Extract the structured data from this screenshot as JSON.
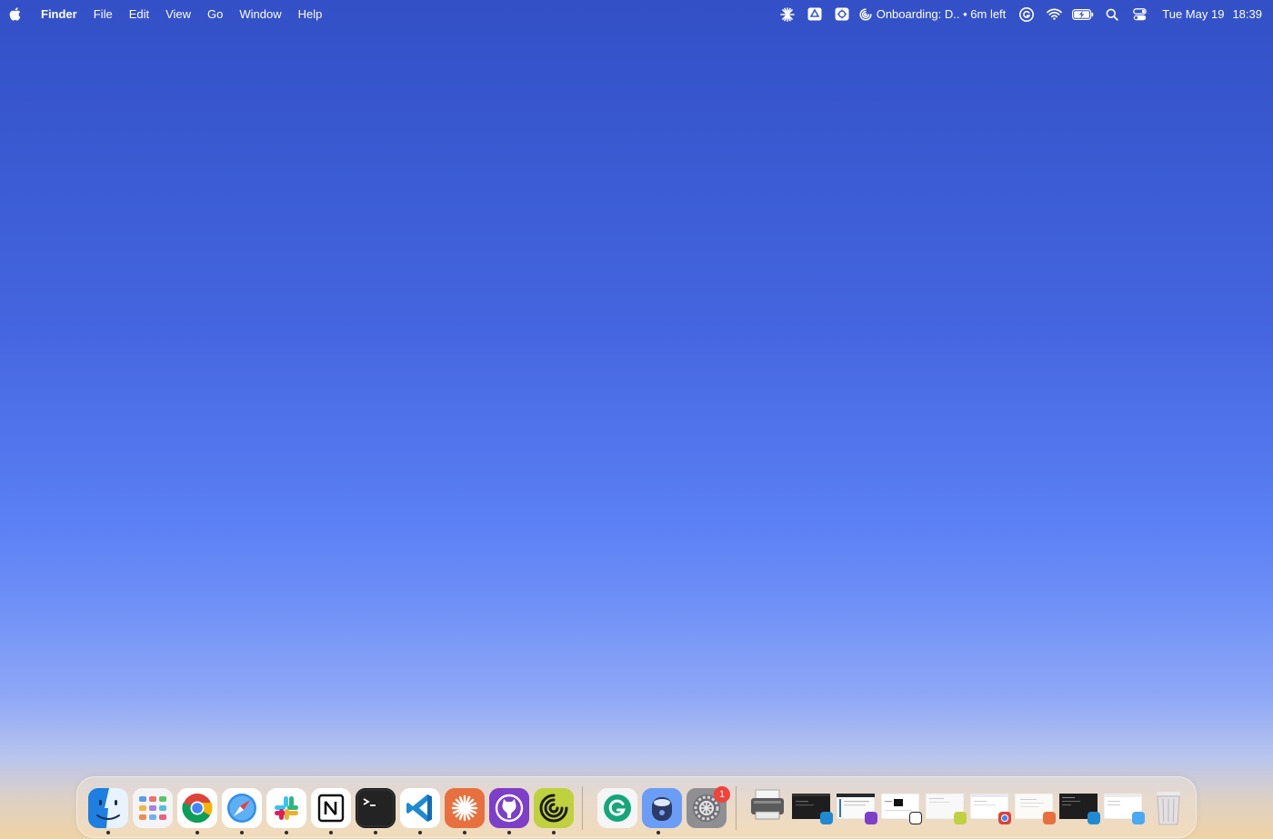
{
  "menubar": {
    "app_name": "Finder",
    "menus": [
      "File",
      "Edit",
      "View",
      "Go",
      "Window",
      "Help"
    ],
    "status_icons": [
      "asterisk-icon",
      "google-drive-icon",
      "gear-badge-icon",
      "focus-timer-icon",
      "grammarly-icon",
      "wifi-icon",
      "battery-charging-icon",
      "search-icon",
      "control-center-icon"
    ],
    "timer_text": "Onboarding: D.. • 6m left",
    "date": "Tue May 19",
    "time": "18:39"
  },
  "dock": {
    "apps": [
      {
        "name": "Finder",
        "icon": "finder-icon",
        "running": true
      },
      {
        "name": "Launchpad",
        "icon": "launchpad-icon",
        "running": false
      },
      {
        "name": "Google Chrome",
        "icon": "chrome-icon",
        "running": true
      },
      {
        "name": "Safari",
        "icon": "safari-icon",
        "running": true
      },
      {
        "name": "Slack",
        "icon": "slack-icon",
        "running": true
      },
      {
        "name": "Notion",
        "icon": "notion-icon",
        "running": true
      },
      {
        "name": "Terminal",
        "icon": "terminal-icon",
        "running": true
      },
      {
        "name": "Visual Studio Code",
        "icon": "vscode-icon",
        "running": true
      },
      {
        "name": "Claude",
        "icon": "claude-icon",
        "running": true
      },
      {
        "name": "GitHub Desktop",
        "icon": "github-desktop-icon",
        "running": true
      },
      {
        "name": "Spiral",
        "icon": "spiral-icon",
        "running": true
      },
      {
        "name": "Grammarly",
        "icon": "grammarly-app-icon",
        "running": false
      },
      {
        "name": "Screen Sharing",
        "icon": "screen-sharing-icon",
        "running": true
      },
      {
        "name": "System Settings",
        "icon": "settings-icon",
        "running": false,
        "badge": "1"
      }
    ],
    "minimized_windows": [
      {
        "icon": "minimized-printer-window-icon"
      },
      {
        "icon": "minimized-vscode-window-icon",
        "app_badge": "vscode"
      },
      {
        "icon": "minimized-github-window-icon",
        "app_badge": "github"
      },
      {
        "icon": "minimized-notion-window-icon",
        "app_badge": "notion"
      },
      {
        "icon": "minimized-spiral-window-icon",
        "app_badge": "spiral"
      },
      {
        "icon": "minimized-chrome-window-icon",
        "app_badge": "chrome"
      },
      {
        "icon": "minimized-claude-window-icon",
        "app_badge": "claude"
      },
      {
        "icon": "minimized-terminal-vscode-window-icon",
        "app_badge": "vscode"
      },
      {
        "icon": "minimized-finder-window-icon",
        "app_badge": "finder"
      }
    ],
    "trash_icon": "trash-icon"
  }
}
